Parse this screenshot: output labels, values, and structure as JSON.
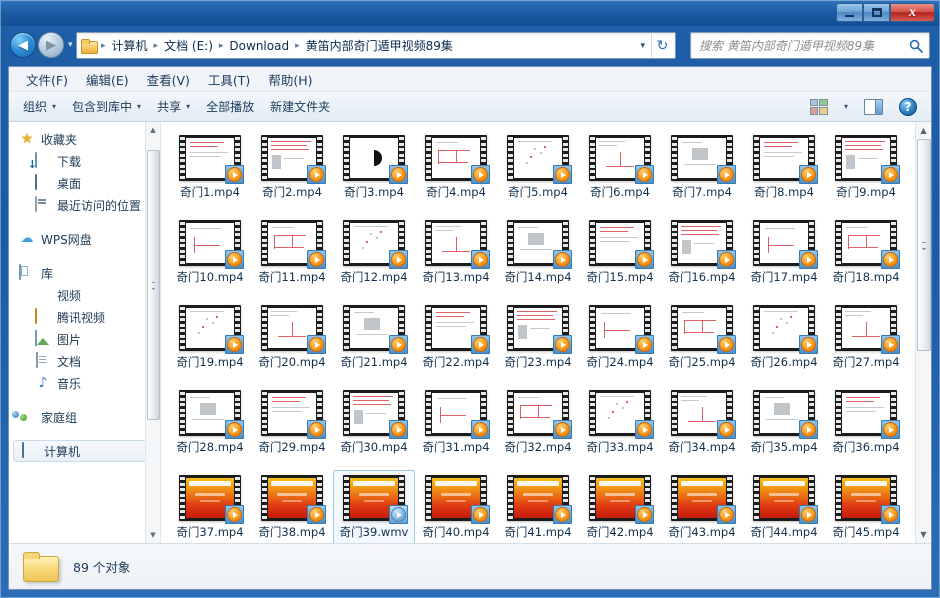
{
  "window": {
    "title": "",
    "buttons": {
      "minimize": "–",
      "maximize": "□",
      "close": "x"
    }
  },
  "nav": {
    "back_label": "◀",
    "forward_label": "▶",
    "history_label": "▾",
    "refresh_label": "↻"
  },
  "address": {
    "folder_icon": "folder-icon",
    "crumbs": [
      "计算机",
      "文档 (E:)",
      "Download",
      "黄笛内部奇门遁甲视频89集"
    ],
    "separator": "▸",
    "dropdown": "▾"
  },
  "search": {
    "placeholder": "搜索 黄笛内部奇门遁甲视频89集",
    "value": "",
    "icon": "search-icon"
  },
  "menubar": [
    "文件(F)",
    "编辑(E)",
    "查看(V)",
    "工具(T)",
    "帮助(H)"
  ],
  "toolbar": {
    "items": [
      {
        "label": "组织",
        "caret": true
      },
      {
        "label": "包含到库中",
        "caret": true
      },
      {
        "label": "共享",
        "caret": true
      },
      {
        "label": "全部播放",
        "caret": false
      },
      {
        "label": "新建文件夹",
        "caret": false
      }
    ],
    "view_caret": "▾",
    "help_label": "?"
  },
  "sidebar": {
    "items": [
      {
        "label": "收藏夹",
        "icon": "star-icon",
        "level": 0,
        "selected": false
      },
      {
        "label": "下载",
        "icon": "download-icon",
        "level": 1,
        "selected": false
      },
      {
        "label": "桌面",
        "icon": "desktop-icon",
        "level": 1,
        "selected": false
      },
      {
        "label": "最近访问的位置",
        "icon": "recent-icon",
        "level": 1,
        "selected": false
      },
      {
        "label": "",
        "icon": "gap",
        "level": 0,
        "selected": false
      },
      {
        "label": "WPS网盘",
        "icon": "cloud-icon",
        "level": 0,
        "selected": false
      },
      {
        "label": "",
        "icon": "gap",
        "level": 0,
        "selected": false
      },
      {
        "label": "库",
        "icon": "library-icon",
        "level": 0,
        "selected": false
      },
      {
        "label": "视频",
        "icon": "video-icon",
        "level": 1,
        "selected": false
      },
      {
        "label": "腾讯视频",
        "icon": "tencent-video-icon",
        "level": 1,
        "selected": false
      },
      {
        "label": "图片",
        "icon": "pictures-icon",
        "level": 1,
        "selected": false
      },
      {
        "label": "文档",
        "icon": "documents-icon",
        "level": 1,
        "selected": false
      },
      {
        "label": "音乐",
        "icon": "music-icon",
        "level": 1,
        "selected": false
      },
      {
        "label": "",
        "icon": "gap",
        "level": 0,
        "selected": false
      },
      {
        "label": "家庭组",
        "icon": "homegroup-icon",
        "level": 0,
        "selected": false
      },
      {
        "label": "",
        "icon": "gap",
        "level": 0,
        "selected": false
      },
      {
        "label": "计算机",
        "icon": "computer-icon",
        "level": 0,
        "selected": true
      }
    ],
    "scroll_up": "▲",
    "scroll_down": "▼"
  },
  "files": {
    "scroll_up": "▲",
    "scroll_down": "▼",
    "items": [
      {
        "name": "奇门1.mp4",
        "thumb": "doc",
        "variant": 1,
        "selected": false
      },
      {
        "name": "奇门2.mp4",
        "thumb": "doc",
        "variant": 2,
        "selected": false
      },
      {
        "name": "奇门3.mp4",
        "thumb": "yin",
        "variant": 3,
        "selected": false
      },
      {
        "name": "奇门4.mp4",
        "thumb": "doc",
        "variant": 4,
        "selected": false
      },
      {
        "name": "奇门5.mp4",
        "thumb": "doc",
        "variant": 5,
        "selected": false
      },
      {
        "name": "奇门6.mp4",
        "thumb": "doc",
        "variant": 6,
        "selected": false
      },
      {
        "name": "奇门7.mp4",
        "thumb": "doc",
        "variant": 7,
        "selected": false
      },
      {
        "name": "奇门8.mp4",
        "thumb": "doc",
        "variant": 1,
        "selected": false
      },
      {
        "name": "奇门9.mp4",
        "thumb": "doc",
        "variant": 2,
        "selected": false
      },
      {
        "name": "奇门10.mp4",
        "thumb": "doc",
        "variant": 3,
        "selected": false
      },
      {
        "name": "奇门11.mp4",
        "thumb": "doc",
        "variant": 4,
        "selected": false
      },
      {
        "name": "奇门12.mp4",
        "thumb": "doc",
        "variant": 5,
        "selected": false
      },
      {
        "name": "奇门13.mp4",
        "thumb": "doc",
        "variant": 6,
        "selected": false
      },
      {
        "name": "奇门14.mp4",
        "thumb": "doc",
        "variant": 7,
        "selected": false
      },
      {
        "name": "奇门15.mp4",
        "thumb": "doc",
        "variant": 1,
        "selected": false
      },
      {
        "name": "奇门16.mp4",
        "thumb": "doc",
        "variant": 2,
        "selected": false
      },
      {
        "name": "奇门17.mp4",
        "thumb": "doc",
        "variant": 3,
        "selected": false
      },
      {
        "name": "奇门18.mp4",
        "thumb": "doc",
        "variant": 4,
        "selected": false
      },
      {
        "name": "奇门19.mp4",
        "thumb": "doc",
        "variant": 5,
        "selected": false
      },
      {
        "name": "奇门20.mp4",
        "thumb": "doc",
        "variant": 6,
        "selected": false
      },
      {
        "name": "奇门21.mp4",
        "thumb": "doc",
        "variant": 7,
        "selected": false
      },
      {
        "name": "奇门22.mp4",
        "thumb": "doc",
        "variant": 1,
        "selected": false
      },
      {
        "name": "奇门23.mp4",
        "thumb": "doc",
        "variant": 2,
        "selected": false
      },
      {
        "name": "奇门24.mp4",
        "thumb": "doc",
        "variant": 3,
        "selected": false
      },
      {
        "name": "奇门25.mp4",
        "thumb": "doc",
        "variant": 4,
        "selected": false
      },
      {
        "name": "奇门26.mp4",
        "thumb": "doc",
        "variant": 5,
        "selected": false
      },
      {
        "name": "奇门27.mp4",
        "thumb": "doc",
        "variant": 6,
        "selected": false
      },
      {
        "name": "奇门28.mp4",
        "thumb": "doc",
        "variant": 7,
        "selected": false
      },
      {
        "name": "奇门29.mp4",
        "thumb": "doc",
        "variant": 1,
        "selected": false
      },
      {
        "name": "奇门30.mp4",
        "thumb": "doc",
        "variant": 2,
        "selected": false
      },
      {
        "name": "奇门31.mp4",
        "thumb": "doc",
        "variant": 3,
        "selected": false
      },
      {
        "name": "奇门32.mp4",
        "thumb": "doc",
        "variant": 4,
        "selected": false
      },
      {
        "name": "奇门33.mp4",
        "thumb": "doc",
        "variant": 5,
        "selected": false
      },
      {
        "name": "奇门34.mp4",
        "thumb": "doc",
        "variant": 6,
        "selected": false
      },
      {
        "name": "奇门35.mp4",
        "thumb": "doc",
        "variant": 7,
        "selected": false
      },
      {
        "name": "奇门36.mp4",
        "thumb": "doc",
        "variant": 1,
        "selected": false
      },
      {
        "name": "奇门37.mp4",
        "thumb": "red",
        "variant": 1,
        "selected": false
      },
      {
        "name": "奇门38.mp4",
        "thumb": "red",
        "variant": 2,
        "selected": false
      },
      {
        "name": "奇门39.wmv",
        "thumb": "red",
        "variant": 3,
        "selected": true
      },
      {
        "name": "奇门40.mp4",
        "thumb": "red",
        "variant": 4,
        "selected": false
      },
      {
        "name": "奇门41.mp4",
        "thumb": "red",
        "variant": 5,
        "selected": false
      },
      {
        "name": "奇门42.mp4",
        "thumb": "red",
        "variant": 6,
        "selected": false
      },
      {
        "name": "奇门43.mp4",
        "thumb": "red",
        "variant": 7,
        "selected": false
      },
      {
        "name": "奇门44.mp4",
        "thumb": "red",
        "variant": 1,
        "selected": false
      },
      {
        "name": "奇门45.mp4",
        "thumb": "red",
        "variant": 2,
        "selected": false
      }
    ]
  },
  "statusbar": {
    "icon": "folder-icon",
    "text": "89 个对象"
  },
  "colors": {
    "frame_blue": "#1b5ca4",
    "accent": "#f7941e",
    "selection": "#9fc9e8",
    "close_red": "#b3231b"
  }
}
